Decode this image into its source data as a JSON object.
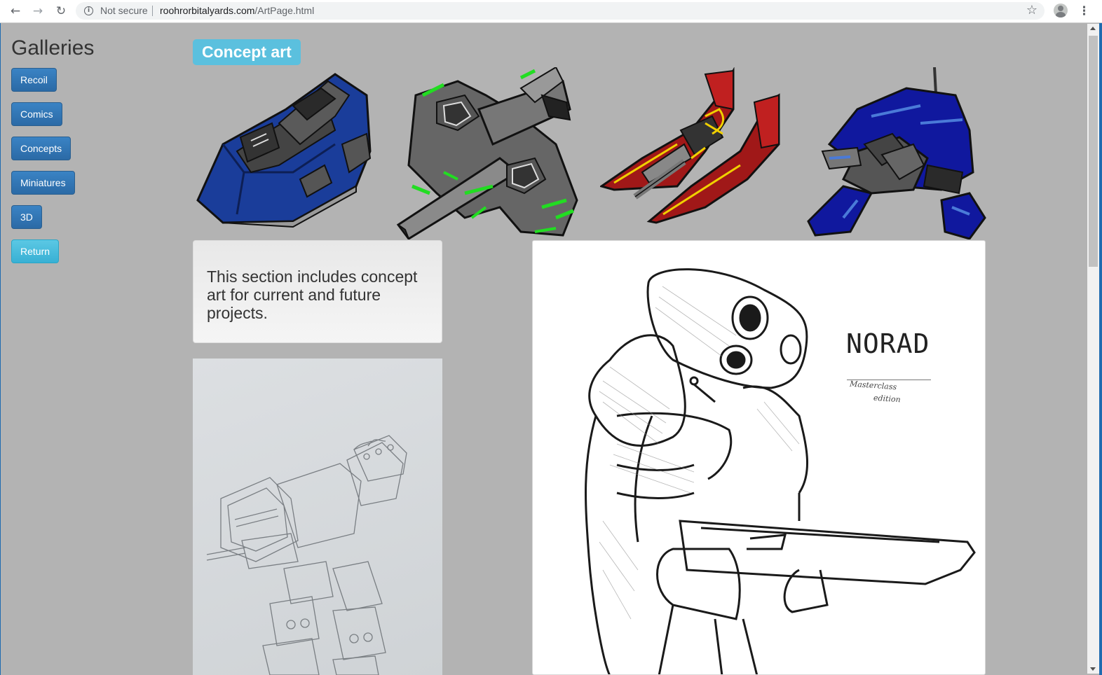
{
  "browser": {
    "security_label": "Not secure",
    "url_domain": "roohrorbitalyards.com",
    "url_path": "/ArtPage.html"
  },
  "sidebar": {
    "title": "Galleries",
    "buttons": [
      {
        "label": "Recoil",
        "style": "primary"
      },
      {
        "label": "Comics",
        "style": "primary"
      },
      {
        "label": "Concepts",
        "style": "primary"
      },
      {
        "label": "Miniatures",
        "style": "primary"
      },
      {
        "label": "3D",
        "style": "primary"
      },
      {
        "label": "Return",
        "style": "info"
      }
    ]
  },
  "main": {
    "section_label": "Concept art",
    "description": "This section includes concept art for current and future projects.",
    "artwork": {
      "norad_title": "NORAD",
      "norad_subtitle_line1": "Masterclass",
      "norad_subtitle_line2": "edition"
    }
  },
  "colors": {
    "page_background": "#b3b3b3",
    "primary_button": "#337ab7",
    "info_label": "#5bc0de",
    "ship_blue": "#1a3d9a",
    "ship_green_accent": "#22dd22",
    "ship_red": "#a01818",
    "ship_navy": "#10189e"
  }
}
